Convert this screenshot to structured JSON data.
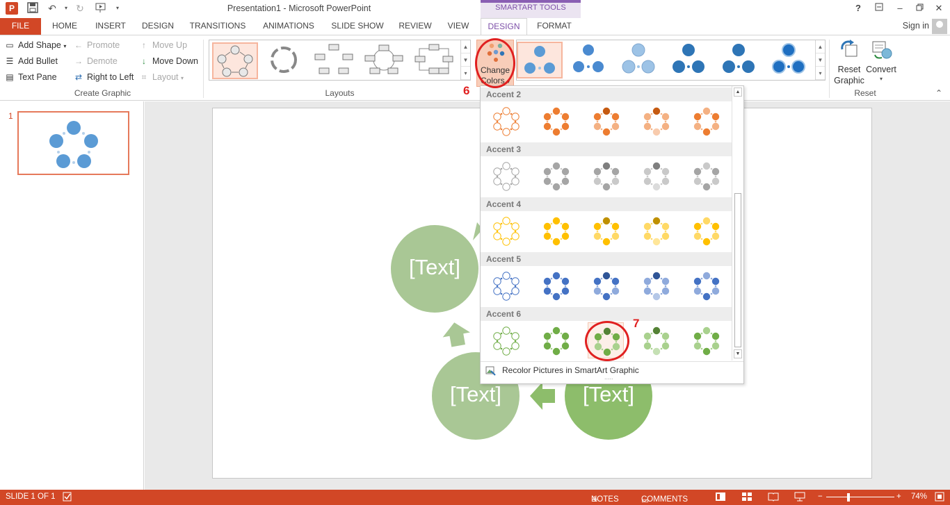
{
  "window": {
    "title": "Presentation1 - Microsoft PowerPoint",
    "context_tab_group": "SMARTART TOOLS",
    "help_glyph": "?",
    "signin": "Sign in"
  },
  "tabs": [
    "FILE",
    "HOME",
    "INSERT",
    "DESIGN",
    "TRANSITIONS",
    "ANIMATIONS",
    "SLIDE SHOW",
    "REVIEW",
    "VIEW",
    "DESIGN",
    "FORMAT"
  ],
  "ribbon": {
    "create_graphic": {
      "add_shape": "Add Shape",
      "add_bullet": "Add Bullet",
      "text_pane": "Text Pane",
      "promote": "Promote",
      "demote": "Demote",
      "right_to_left": "Right to Left",
      "move_up": "Move Up",
      "move_down": "Move Down",
      "layout": "Layout",
      "group_label": "Create Graphic"
    },
    "layouts_label": "Layouts",
    "change_colors_line1": "Change",
    "change_colors_line2": "Colors",
    "reset_graphic_line1": "Reset",
    "reset_graphic_line2": "Graphic",
    "convert": "Convert",
    "reset_label": "Reset"
  },
  "thumbnail": {
    "number": "1"
  },
  "slide_texts": [
    "[Text]",
    "[Text]",
    "[Text]"
  ],
  "colors_dropdown": {
    "sections": [
      "Accent 2",
      "Accent 3",
      "Accent 4",
      "Accent 5",
      "Accent 6"
    ],
    "footer": "Recolor Pictures in SmartArt Graphic",
    "footer_dots": "....."
  },
  "annotations": {
    "step6": "6",
    "step7": "7"
  },
  "status": {
    "slide_info": "SLIDE 1 OF 1",
    "notes": "NOTES",
    "comments": "COMMENTS",
    "zoom": "74%"
  },
  "palette": {
    "accent_office_orange": "#d24726",
    "smartart_purple": "#7d4fa8",
    "accent2": "#ed7d31",
    "accent3": "#a5a5a5",
    "accent4": "#ffc000",
    "accent5": "#4472c4",
    "accent6": "#70ad47",
    "slide_green": "#a9c795"
  }
}
